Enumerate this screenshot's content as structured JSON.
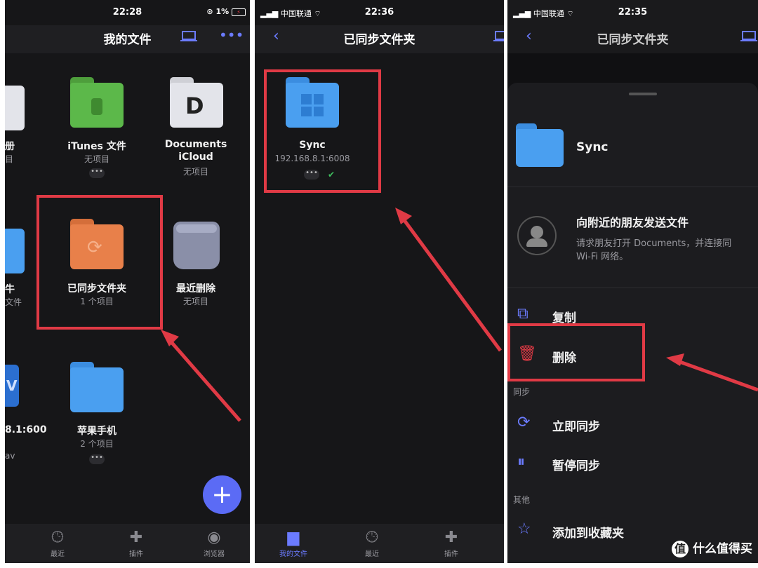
{
  "panel1": {
    "status": {
      "time": "22:28",
      "battery": "1%"
    },
    "title": "我的文件",
    "items": [
      {
        "name": "iTunes 文件",
        "sub": "无项目"
      },
      {
        "name": "Documents",
        "name2": "iCloud",
        "sub": "无项目"
      },
      {
        "name": "已同步文件夹",
        "sub": "1 个项目"
      },
      {
        "name": "最近删除",
        "sub": "无项目"
      },
      {
        "name": "苹果手机",
        "sub": "2 个项目"
      }
    ],
    "partial": {
      "a": "册",
      "b": "目",
      "c": "牛",
      "d": "文件",
      "e": "8.1:600",
      "f": "av"
    },
    "tabs": [
      "最近",
      "插件",
      "浏览器"
    ]
  },
  "panel2": {
    "status": {
      "carrier": "中国联通",
      "time": "22:36"
    },
    "title": "已同步文件夹",
    "folder": {
      "name": "Sync",
      "sub": "192.168.8.1:6008"
    },
    "tabs": [
      "我的文件",
      "最近",
      "插件"
    ]
  },
  "panel3": {
    "status": {
      "carrier": "中国联通",
      "time": "22:35"
    },
    "title": "已同步文件夹",
    "folder_name": "Sync",
    "share_title": "向附近的朋友发送文件",
    "share_desc1": "请求朋友打开 Documents，并连接同",
    "share_desc2": "Wi-Fi 网络。",
    "menu": {
      "copy": "复制",
      "delete": "删除",
      "sync_now": "立即同步",
      "pause_sync": "暂停同步",
      "favorite": "添加到收藏夹"
    },
    "sections": {
      "sync": "同步",
      "other": "其他"
    }
  },
  "watermark": "什么值得买",
  "colors": {
    "accent": "#6b7bff",
    "red": "#e03a45",
    "folder_blue": "#4a9ff0",
    "folder_orange": "#e8804a",
    "folder_green": "#5cb84a"
  }
}
